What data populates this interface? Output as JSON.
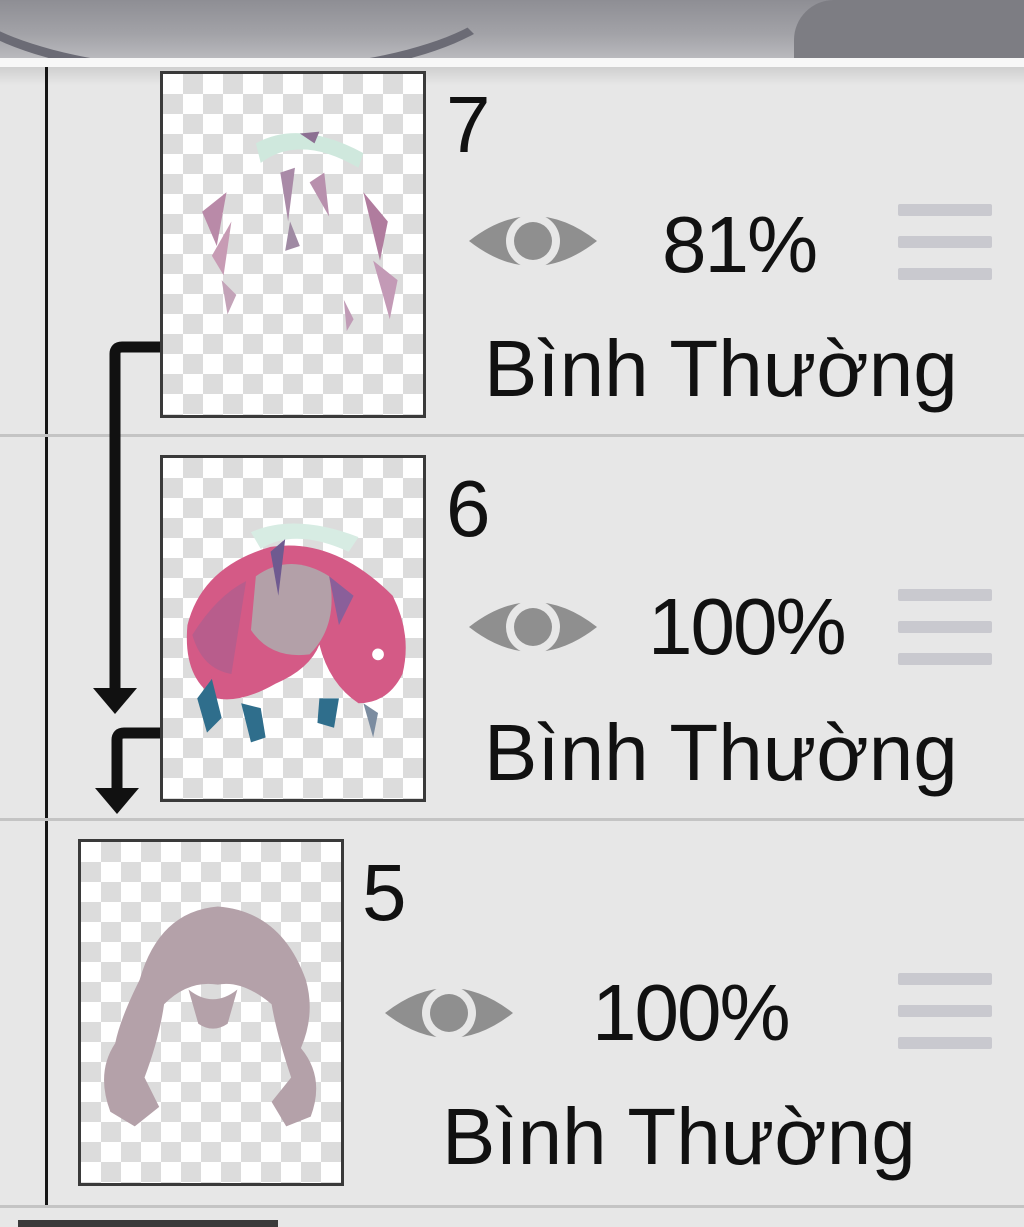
{
  "layers": [
    {
      "number": "7",
      "opacity": "81%",
      "blend_mode": "Bình Thường",
      "visible": true,
      "clipped": true
    },
    {
      "number": "6",
      "opacity": "100%",
      "blend_mode": "Bình Thường",
      "visible": true,
      "clipped": true
    },
    {
      "number": "5",
      "opacity": "100%",
      "blend_mode": "Bình Thường",
      "visible": true,
      "clipped": false
    }
  ],
  "icons": {
    "visibility": "eye-icon",
    "reorder": "drag-handle-icon",
    "clipping": "clipping-arrow-icon"
  },
  "colors": {
    "panel_bg": "#e7e7e7",
    "eye_gray": "#8f8f8f",
    "handle_gray": "#c9c9cf",
    "text": "#111111"
  }
}
